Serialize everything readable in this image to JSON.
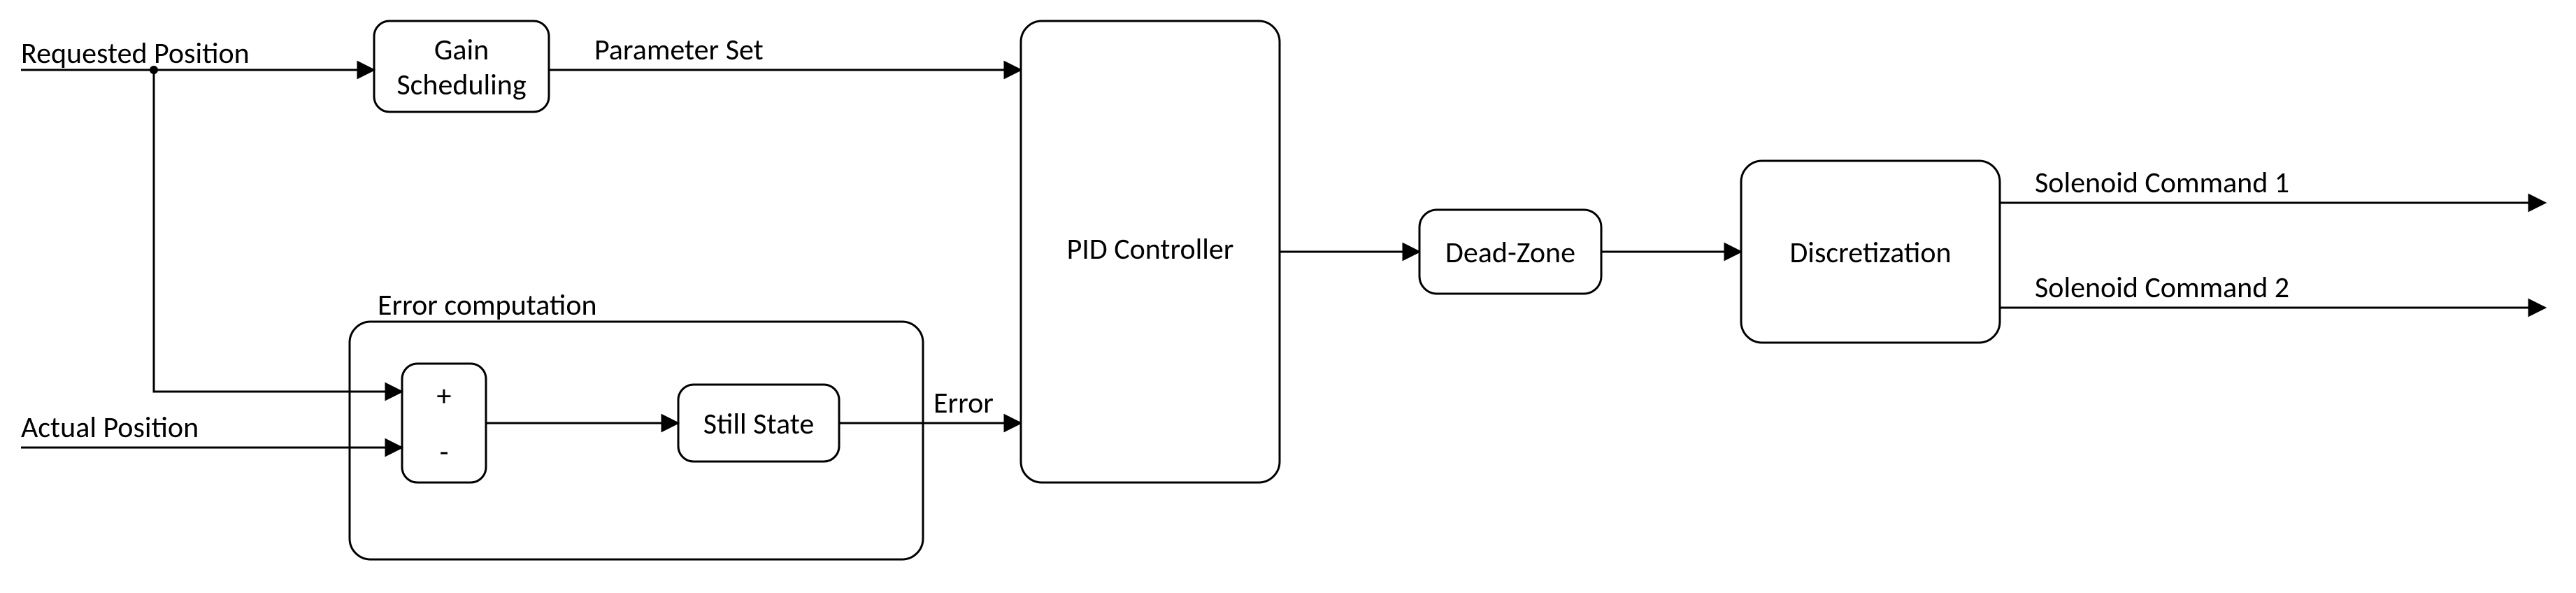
{
  "inputs": {
    "requested_position": "Requested Position",
    "actual_position": "Actual Position"
  },
  "blocks": {
    "gain_scheduling_line1": "Gain",
    "gain_scheduling_line2": "Scheduling",
    "error_computation": "Error computation",
    "sum_plus": "+",
    "sum_minus": "-",
    "still_state": "Still State",
    "pid": "PID Controller",
    "dead_zone": "Dead-Zone",
    "discretization": "Discretization"
  },
  "signals": {
    "parameter_set": "Parameter Set",
    "error": "Error"
  },
  "outputs": {
    "solenoid_1": "Solenoid Command 1",
    "solenoid_2": "Solenoid Command 2"
  }
}
